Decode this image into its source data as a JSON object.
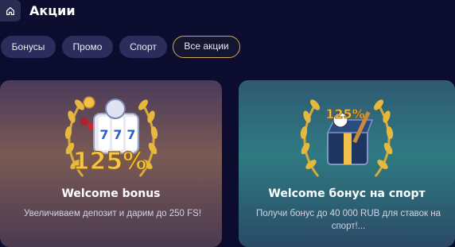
{
  "header": {
    "title": "Акции",
    "home_icon": "home-icon"
  },
  "tabs": [
    {
      "label": "Бонусы",
      "active": false
    },
    {
      "label": "Промо",
      "active": false
    },
    {
      "label": "Спорт",
      "active": false
    },
    {
      "label": "Все акции",
      "active": true
    }
  ],
  "cards": [
    {
      "title": "Welcome bonus",
      "description": "Увеличиваем депозит и дарим до 250 FS!",
      "badge": "125%"
    },
    {
      "title": "Welcome бонус на спорт",
      "description": "Получи бонус до 40 000 RUB для ставок на спорт!...",
      "badge": "125%"
    }
  ],
  "colors": {
    "background": "#0b0c2e",
    "tab": "#2b2d5c",
    "active_tab_border": "#d4a85a",
    "gold": "#e0b33a"
  }
}
